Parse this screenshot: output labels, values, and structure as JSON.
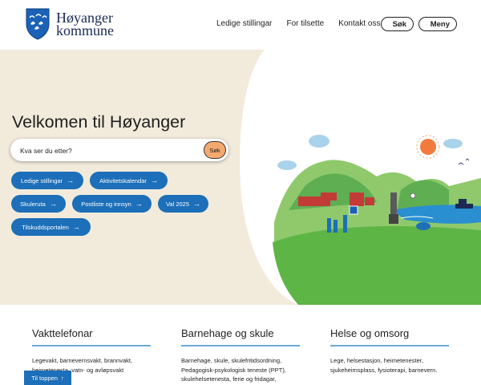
{
  "header": {
    "logo_line1": "Høyanger",
    "logo_line2": "kommune",
    "nav": [
      "Ledige stillingar",
      "For tilsette",
      "Kontakt oss"
    ],
    "search_label": "Søk",
    "menu_label": "Meny"
  },
  "hero": {
    "title": "Velkomen til Høyanger",
    "search_placeholder": "Kva ser du etter?",
    "search_button": "Søk",
    "quick_links": [
      "Ledige stillingar",
      "Aktivitetskalendar",
      "Skuleruta",
      "Postliste og innsyn",
      "Val 2025",
      "Tilskuddsportalen"
    ]
  },
  "columns": [
    {
      "title": "Vakttelefonar",
      "text": "Legevakt, barnevernsvakt, brannvakt, heimetenesta, vatn- og avløpsvakt"
    },
    {
      "title": "Barnehage og skule",
      "text": "Barnehage, skule, skulefritidsordning, Pedagogisk-psykologisk teneste (PPT), skulehelsetenesta, ferie og fridagar,"
    },
    {
      "title": "Helse og omsorg",
      "text": "Lege, helsestasjon, heimetenester, sjukeheimsplass, fysioterapi, barnevern."
    }
  ],
  "to_top": "Til toppen",
  "colors": {
    "primary": "#1c6fb8",
    "hero_bg": "#f2ebdc",
    "search_button": "#f4a96f",
    "accent_rule": "#6aa9da"
  },
  "icons": [
    "coat-of-arms-logo",
    "search-icon",
    "menu-icon",
    "arrow-right-icon",
    "arrow-up-icon"
  ]
}
